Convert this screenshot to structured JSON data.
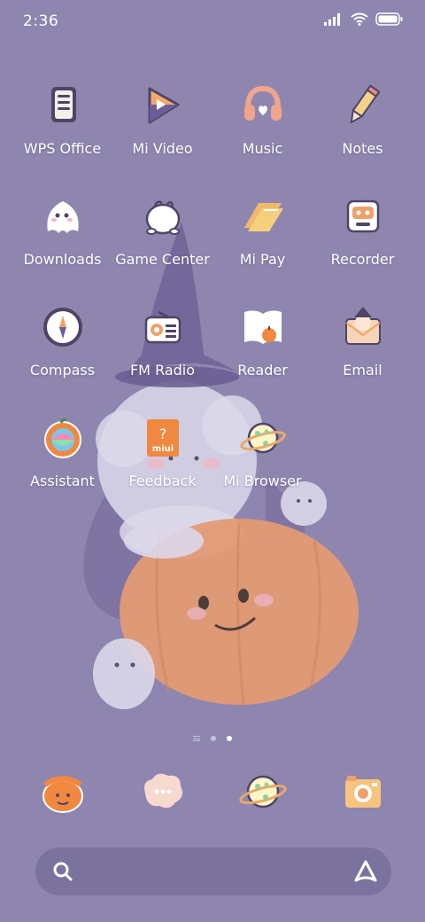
{
  "status_bar": {
    "time": "2:36"
  },
  "apps": [
    {
      "label": "WPS Office"
    },
    {
      "label": "Mi Video"
    },
    {
      "label": "Music"
    },
    {
      "label": "Notes"
    },
    {
      "label": "Downloads"
    },
    {
      "label": "Game Center"
    },
    {
      "label": "Mi Pay"
    },
    {
      "label": "Recorder"
    },
    {
      "label": "Compass"
    },
    {
      "label": "FM Radio"
    },
    {
      "label": "Reader"
    },
    {
      "label": "Email"
    },
    {
      "label": "Assistant"
    },
    {
      "label": "Feedback"
    },
    {
      "label": "Mi Browser"
    }
  ],
  "page_indicator": {
    "pages": 2,
    "active": 2
  },
  "dock": [
    {
      "icon": "phone-icon"
    },
    {
      "icon": "messages-icon"
    },
    {
      "icon": "browser-icon"
    },
    {
      "icon": "camera-icon"
    }
  ],
  "feedback_icon_text": "miui",
  "colors": {
    "background": "#8f86b0",
    "pumpkin": "#e39a74",
    "accent_orange": "#f08a4b",
    "ghost": "#e6e2f2"
  }
}
